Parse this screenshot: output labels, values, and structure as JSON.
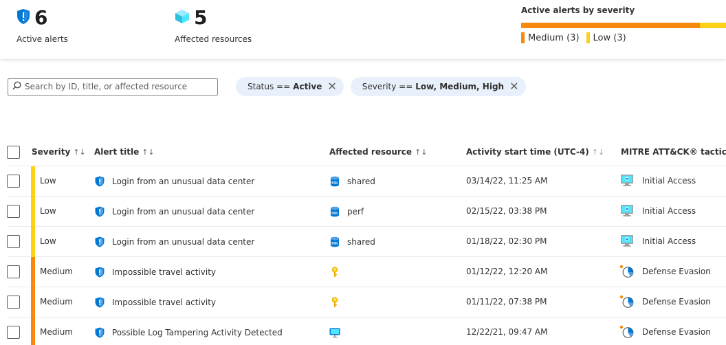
{
  "summary": {
    "active_alerts": {
      "count": "6",
      "label": "Active alerts"
    },
    "affected_resources": {
      "count": "5",
      "label": "Affected resources"
    },
    "severity": {
      "title": "Active alerts by severity",
      "medium_label": "Medium (3)",
      "low_label": "Low (3)",
      "medium_count": 3,
      "low_count": 3,
      "medium_color": "#f7890c",
      "low_color": "#fcd116"
    }
  },
  "filters": {
    "search_placeholder": "Search by ID, title, or affected resource",
    "status_pill": {
      "prefix": "Status ==",
      "value": "Active"
    },
    "severity_pill": {
      "prefix": "Severity ==",
      "value": "Low, Medium, High"
    }
  },
  "table": {
    "columns": {
      "severity": "Severity",
      "title": "Alert title",
      "resource": "Affected resource",
      "start": "Activity start time (UTC-4)",
      "mitre": "MITRE ATT&CK® tactics"
    },
    "sort_glyph": "↑↓",
    "rows": [
      {
        "severity": "Low",
        "title": "Login from an unusual data center",
        "resource": "shared",
        "resource_icon": "sql-icon",
        "start": "03/14/22, 11:25 AM",
        "tactic": "Initial Access",
        "tactic_icon": "initial-access-icon"
      },
      {
        "severity": "Low",
        "title": "Login from an unusual data center",
        "resource": "perf",
        "resource_icon": "sql-icon",
        "start": "02/15/22, 03:38 PM",
        "tactic": "Initial Access",
        "tactic_icon": "initial-access-icon"
      },
      {
        "severity": "Low",
        "title": "Login from an unusual data center",
        "resource": "shared",
        "resource_icon": "sql-icon",
        "start": "01/18/22, 02:30 PM",
        "tactic": "Initial Access",
        "tactic_icon": "initial-access-icon"
      },
      {
        "severity": "Medium",
        "title": "Impossible travel activity",
        "resource": "",
        "resource_icon": "key-icon",
        "start": "01/12/22, 12:20 AM",
        "tactic": "Defense Evasion",
        "tactic_icon": "defense-evasion-icon"
      },
      {
        "severity": "Medium",
        "title": "Impossible travel activity",
        "resource": "",
        "resource_icon": "key-icon",
        "start": "01/11/22, 07:38 PM",
        "tactic": "Defense Evasion",
        "tactic_icon": "defense-evasion-icon"
      },
      {
        "severity": "Medium",
        "title": "Possible Log Tampering Activity Detected",
        "resource": "",
        "resource_icon": "monitor-icon",
        "start": "12/22/21, 09:47 AM",
        "tactic": "Defense Evasion",
        "tactic_icon": "defense-evasion-icon"
      }
    ]
  },
  "colors": {
    "low": "#fcd116",
    "medium": "#f7890c",
    "accent": "#0078d4",
    "pill_bg": "#e8f1fb"
  }
}
